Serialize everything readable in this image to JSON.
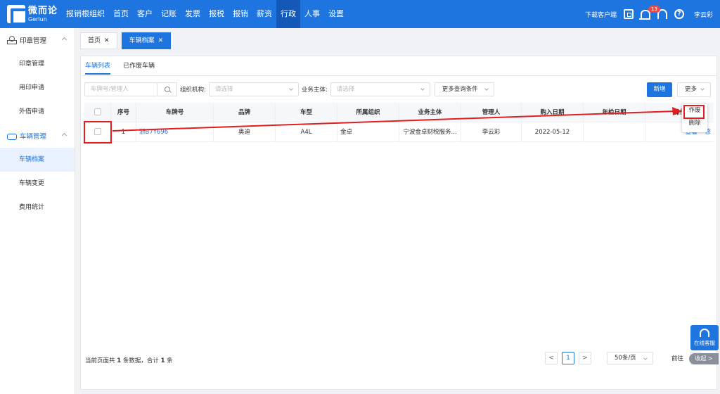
{
  "app": {
    "logo_cn": "微而论",
    "logo_en": "Gerlun",
    "nav": [
      "报销根组织",
      "首页",
      "客户",
      "记账",
      "发票",
      "报税",
      "报销",
      "薪资",
      "行政",
      "人事",
      "设置"
    ],
    "download": "下载客户端",
    "badge": "13",
    "user": "李云彩",
    "icons": [
      "scan-icon",
      "bell-icon",
      "headset-icon",
      "help-icon"
    ]
  },
  "sidebar": {
    "group1": "印章管理",
    "group1_items": [
      "印章管理",
      "用印申请",
      "外借申请"
    ],
    "group2": "车辆管理",
    "group2_items": [
      "车辆档案",
      "车辆变更",
      "费用统计"
    ]
  },
  "page_tabs": [
    {
      "label": "首页",
      "close": "✕"
    },
    {
      "label": "车辆档案",
      "close": "✕"
    }
  ],
  "subtabs": [
    "车辆列表",
    "已作废车辆"
  ],
  "filters": {
    "plate_placeholder": "车牌号/管理人",
    "org_label": "组织机构:",
    "org_placeholder": "请选择",
    "entity_label": "业务主体:",
    "entity_placeholder": "请选择",
    "more_conditions": "更多查询条件"
  },
  "buttons": {
    "new": "新增",
    "more": "更多"
  },
  "table": {
    "headers": [
      "序号",
      "车牌号",
      "品牌",
      "车型",
      "所属组织",
      "业务主体",
      "管理人",
      "购入日期",
      "年检日期",
      "操作"
    ],
    "rows": [
      {
        "index": "1",
        "plate": "浙B7Y696",
        "brand": "奥迪",
        "model": "A4L",
        "org": "金卓",
        "entity": "宁波金卓财税服务...",
        "manager": "李云彩",
        "purchase_date": "2022-05-12",
        "inspection_date": "",
        "op_view": "查看",
        "op_edit": "修"
      }
    ]
  },
  "dropdown": {
    "items": [
      "作废",
      "删除"
    ]
  },
  "footer": {
    "info_prefix": "当前页面共",
    "info_count": "1",
    "info_mid": "条数据，合计",
    "info_total": "1",
    "info_suffix": "条",
    "prev": "<",
    "page": "1",
    "next": ">",
    "page_size": "50条/页",
    "goto": "前往"
  },
  "service": {
    "label": "在线客服",
    "collapse": "收起 >"
  }
}
